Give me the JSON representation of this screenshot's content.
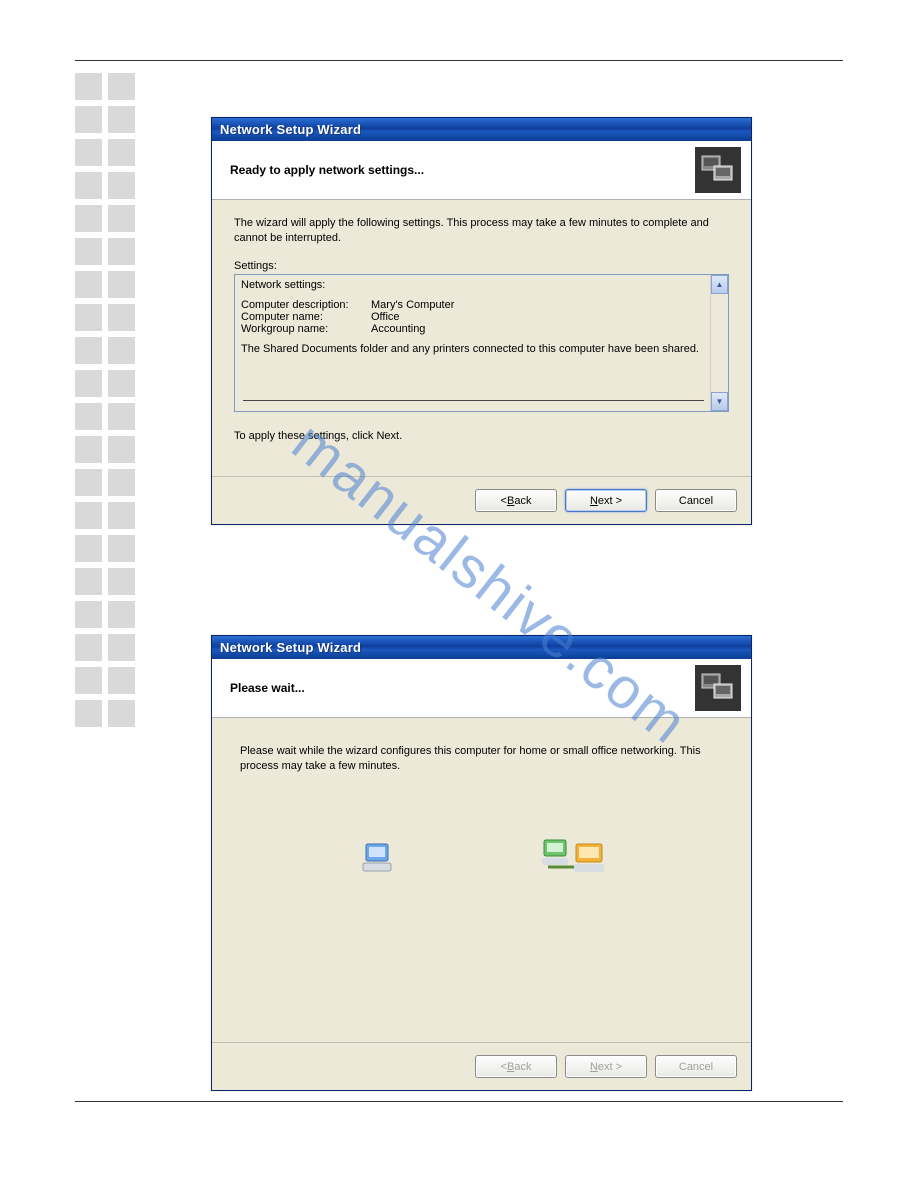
{
  "watermark": "manualshive.com",
  "dialog1": {
    "title": "Network Setup Wizard",
    "heading": "Ready to apply network settings...",
    "intro": "The wizard will apply the following settings. This process may take a few minutes to complete and cannot be interrupted.",
    "settings_label": "Settings:",
    "box_heading": "Network settings:",
    "rows": [
      {
        "label": "Computer description:",
        "value": "Mary's Computer"
      },
      {
        "label": "Computer name:",
        "value": "Office"
      },
      {
        "label": "Workgroup name:",
        "value": "Accounting"
      }
    ],
    "shared_text": "The Shared Documents folder and any printers connected to this computer have been shared.",
    "apply_hint": "To apply these settings, click Next.",
    "buttons": {
      "back": "< Back",
      "next": "Next >",
      "cancel": "Cancel"
    }
  },
  "dialog2": {
    "title": "Network Setup Wizard",
    "heading": "Please wait...",
    "intro": "Please wait while the wizard configures this computer for home or small office networking. This process may take a few minutes.",
    "buttons": {
      "back": "< Back",
      "next": "Next >",
      "cancel": "Cancel"
    }
  }
}
